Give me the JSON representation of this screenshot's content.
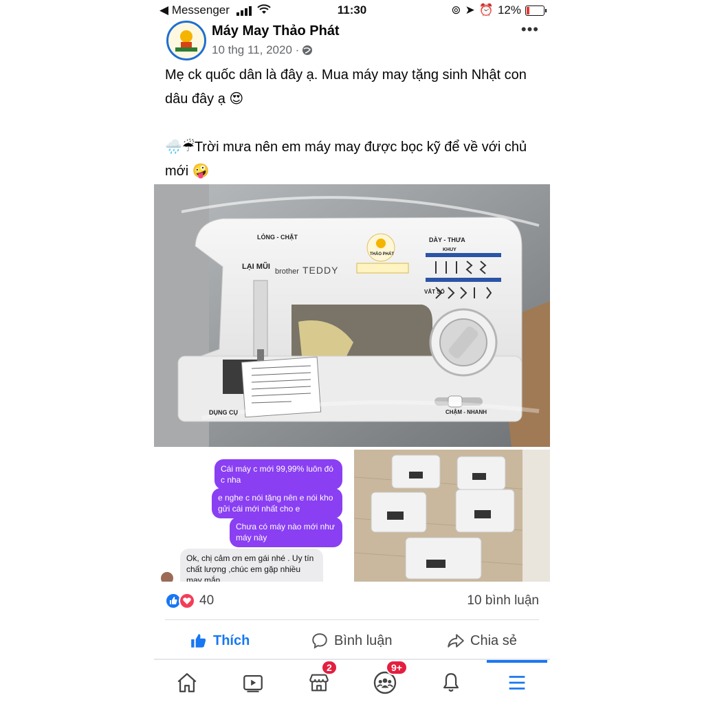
{
  "status_bar": {
    "app": "Messenger",
    "time": "11:30",
    "battery": "12%"
  },
  "post": {
    "page_name": "Máy May Thảo Phát",
    "date": "10 thg 11, 2020 ·",
    "paragraph1": "Mẹ ck quốc dân là đây ạ. Mua máy may tặng sinh Nhật con dâu đây ạ 😍",
    "paragraph2": "🌧️☔Trời mưa nên em máy may được bọc kỹ để về với chủ mới 🤪"
  },
  "photo_labels": {
    "tension": "LỎNG - CHẶT",
    "reverse": "LẠI MŨI",
    "brand": "brother",
    "model": "TEDDY",
    "stitch_length": "DÀY - THƯA",
    "buttonhole": "KHUY",
    "overlock": "VẮT SỔ",
    "tools": "DỤNG CỤ",
    "speed": "CHẬM - NHANH",
    "logo": "THẢO PHÁT"
  },
  "chat": {
    "messages": [
      "Cái máy c mới 99,99% luôn đó c nha",
      "e nghe c nói tặng nên e nói kho gửi cái mới nhất cho e",
      "Chưa có máy nào mới như máy này",
      "Ok, chị cảm ơn em gái nhé . Uy tín chất lượng ,chúc em gặp nhiều may mắn ."
    ]
  },
  "reactions": {
    "count": "40",
    "comments": "10 bình luận"
  },
  "actions": {
    "like": "Thích",
    "comment": "Bình luận",
    "share": "Chia sẻ"
  },
  "tabbar": {
    "marketplace_badge": "2",
    "groups_badge": "9+"
  },
  "colors": {
    "facebook_blue": "#1877f2",
    "messenger_purple": "#8a3ff2",
    "badge_red": "#e41e3f"
  },
  "icons": [
    "back-arrow-icon",
    "signal-icon",
    "wifi-icon",
    "lock-rotation-icon",
    "location-icon",
    "alarm-icon",
    "battery-icon",
    "more-icon",
    "globe-icon",
    "like-reaction-icon",
    "love-reaction-icon",
    "like-icon",
    "comment-icon",
    "share-icon",
    "home-icon",
    "video-icon",
    "marketplace-icon",
    "groups-icon",
    "bell-icon",
    "menu-icon"
  ]
}
